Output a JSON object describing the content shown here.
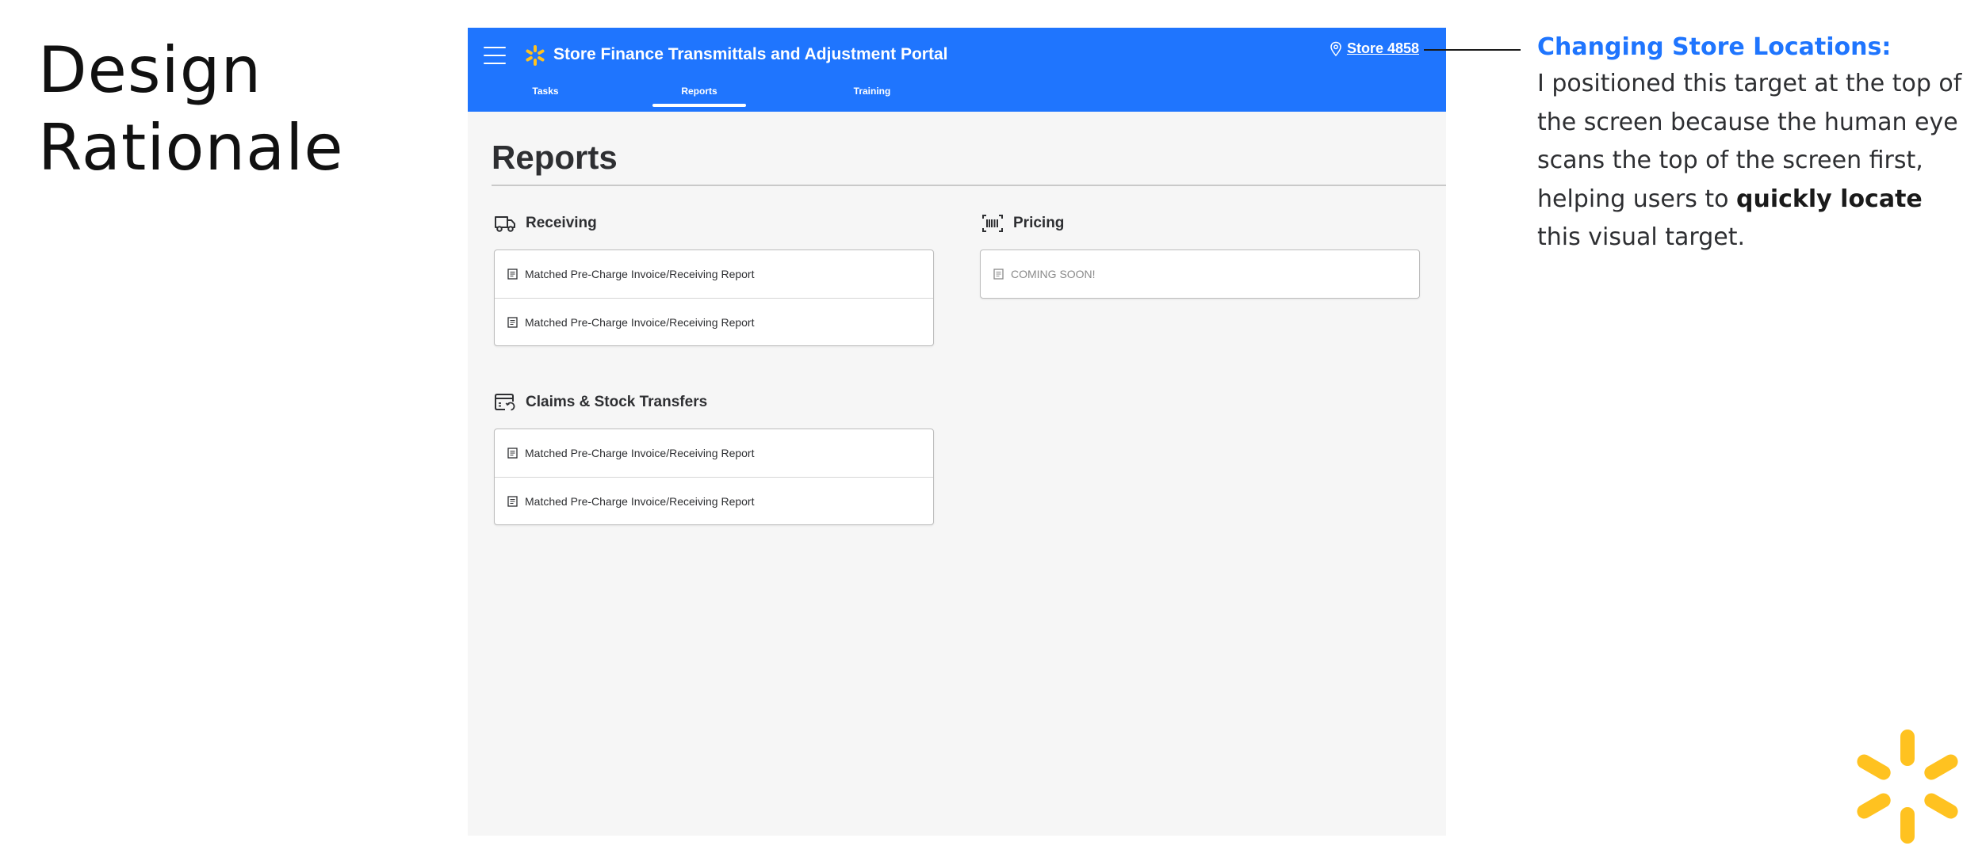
{
  "slide": {
    "title_line1": "Design",
    "title_line2": "Rationale"
  },
  "app": {
    "title": "Store Finance Transmittals and Adjustment Portal",
    "store_label": "Store 4858",
    "tabs": [
      {
        "label": "Tasks",
        "active": false
      },
      {
        "label": "Reports",
        "active": true
      },
      {
        "label": "Training",
        "active": false
      }
    ],
    "page_heading": "Reports",
    "sections": {
      "receiving": {
        "title": "Receiving",
        "items": [
          "Matched Pre-Charge Invoice/Receiving Report",
          "Matched Pre-Charge Invoice/Receiving Report"
        ]
      },
      "pricing": {
        "title": "Pricing",
        "items": [
          "COMING SOON!"
        ]
      },
      "claims": {
        "title": "Claims & Stock Transfers",
        "items": [
          "Matched Pre-Charge Invoice/Receiving Report",
          "Matched Pre-Charge Invoice/Receiving Report"
        ]
      }
    },
    "icons": {
      "menu": "hamburger-icon",
      "brand": "spark-icon",
      "location": "location-pin-icon",
      "receiving": "truck-icon",
      "pricing": "barcode-icon",
      "claims": "transfer-icon",
      "report": "document-icon"
    }
  },
  "annotation": {
    "title": "Changing Store Locations:",
    "body_before": "I positioned this target at the top of the screen because the human eye scans the top of the screen first, helping users to ",
    "body_emphasis": "quickly locate",
    "body_after": " this visual target."
  },
  "colors": {
    "brand_blue": "#1f75fe",
    "spark_yellow": "#ffc220",
    "page_bg": "#f6f6f6",
    "text_dark": "#2e2f32"
  }
}
